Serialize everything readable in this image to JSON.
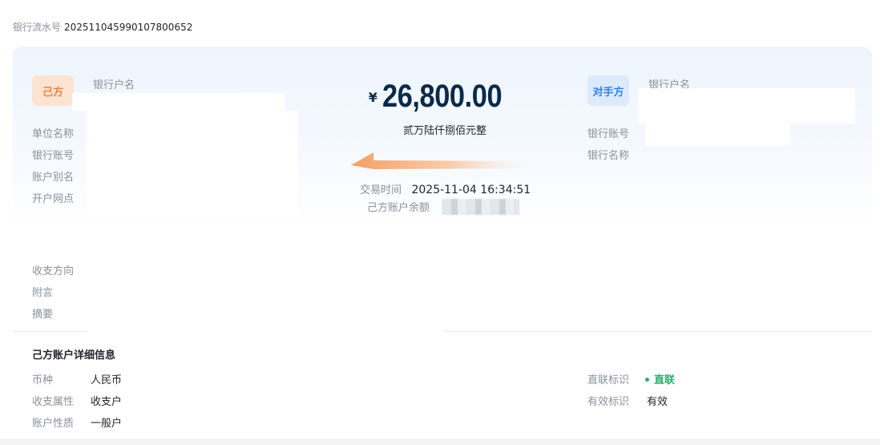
{
  "serial": {
    "label": "银行流水号",
    "value": "2025110459901078​00652"
  },
  "own_party": {
    "badge": "己方",
    "labels": {
      "bank_account_name": "银行户名",
      "unit_name": "单位名称",
      "bank_account_no": "银行账号",
      "account_alias": "账户别名",
      "branch": "开户网点"
    }
  },
  "counterparty": {
    "badge": "对手方",
    "labels": {
      "bank_account_name": "银行户名",
      "bank_account_no": "银行账号",
      "bank_name": "银行名称"
    }
  },
  "transaction": {
    "currency_symbol": "¥",
    "amount": "26,800.00",
    "amount_in_words": "贰万陆仟捌佰元整",
    "time_label": "交易时间",
    "time_value": "2025-11-04 16:34:51",
    "balance_label": "己方账户余额"
  },
  "extra_labels": {
    "direction": "收支方向",
    "remark": "附言",
    "summary": "摘要"
  },
  "details": {
    "title": "己方账户详细信息",
    "currency_label": "币种",
    "currency_value": "人民币",
    "io_attr_label": "收支属性",
    "io_attr_value": "收支户",
    "account_type_label": "账户性质",
    "account_type_value": "一般户",
    "direct_label": "直联标识",
    "direct_value": "直联",
    "valid_label": "有效标识",
    "valid_value": "有效"
  },
  "colors": {
    "own_badge_bg": "#fde3d2",
    "own_badge_text": "#e8853f",
    "cp_badge_bg": "#dcebfc",
    "cp_badge_text": "#2f80ed",
    "amount_text": "#0b2a4a",
    "direct_green": "#27b06a",
    "arrow_orange": "#f6a26a"
  }
}
